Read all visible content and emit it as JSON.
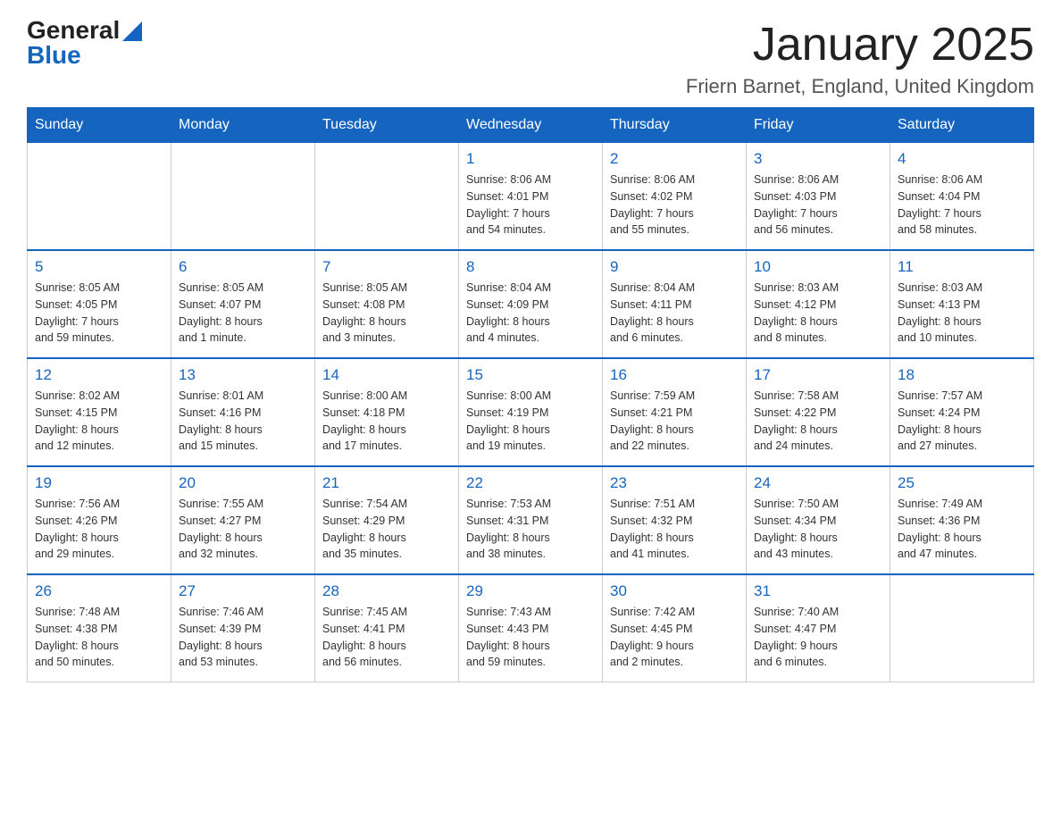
{
  "header": {
    "logo_general": "General",
    "logo_blue": "Blue",
    "title": "January 2025",
    "location": "Friern Barnet, England, United Kingdom"
  },
  "weekdays": [
    "Sunday",
    "Monday",
    "Tuesday",
    "Wednesday",
    "Thursday",
    "Friday",
    "Saturday"
  ],
  "weeks": [
    [
      {
        "day": "",
        "info": ""
      },
      {
        "day": "",
        "info": ""
      },
      {
        "day": "",
        "info": ""
      },
      {
        "day": "1",
        "info": "Sunrise: 8:06 AM\nSunset: 4:01 PM\nDaylight: 7 hours\nand 54 minutes."
      },
      {
        "day": "2",
        "info": "Sunrise: 8:06 AM\nSunset: 4:02 PM\nDaylight: 7 hours\nand 55 minutes."
      },
      {
        "day": "3",
        "info": "Sunrise: 8:06 AM\nSunset: 4:03 PM\nDaylight: 7 hours\nand 56 minutes."
      },
      {
        "day": "4",
        "info": "Sunrise: 8:06 AM\nSunset: 4:04 PM\nDaylight: 7 hours\nand 58 minutes."
      }
    ],
    [
      {
        "day": "5",
        "info": "Sunrise: 8:05 AM\nSunset: 4:05 PM\nDaylight: 7 hours\nand 59 minutes."
      },
      {
        "day": "6",
        "info": "Sunrise: 8:05 AM\nSunset: 4:07 PM\nDaylight: 8 hours\nand 1 minute."
      },
      {
        "day": "7",
        "info": "Sunrise: 8:05 AM\nSunset: 4:08 PM\nDaylight: 8 hours\nand 3 minutes."
      },
      {
        "day": "8",
        "info": "Sunrise: 8:04 AM\nSunset: 4:09 PM\nDaylight: 8 hours\nand 4 minutes."
      },
      {
        "day": "9",
        "info": "Sunrise: 8:04 AM\nSunset: 4:11 PM\nDaylight: 8 hours\nand 6 minutes."
      },
      {
        "day": "10",
        "info": "Sunrise: 8:03 AM\nSunset: 4:12 PM\nDaylight: 8 hours\nand 8 minutes."
      },
      {
        "day": "11",
        "info": "Sunrise: 8:03 AM\nSunset: 4:13 PM\nDaylight: 8 hours\nand 10 minutes."
      }
    ],
    [
      {
        "day": "12",
        "info": "Sunrise: 8:02 AM\nSunset: 4:15 PM\nDaylight: 8 hours\nand 12 minutes."
      },
      {
        "day": "13",
        "info": "Sunrise: 8:01 AM\nSunset: 4:16 PM\nDaylight: 8 hours\nand 15 minutes."
      },
      {
        "day": "14",
        "info": "Sunrise: 8:00 AM\nSunset: 4:18 PM\nDaylight: 8 hours\nand 17 minutes."
      },
      {
        "day": "15",
        "info": "Sunrise: 8:00 AM\nSunset: 4:19 PM\nDaylight: 8 hours\nand 19 minutes."
      },
      {
        "day": "16",
        "info": "Sunrise: 7:59 AM\nSunset: 4:21 PM\nDaylight: 8 hours\nand 22 minutes."
      },
      {
        "day": "17",
        "info": "Sunrise: 7:58 AM\nSunset: 4:22 PM\nDaylight: 8 hours\nand 24 minutes."
      },
      {
        "day": "18",
        "info": "Sunrise: 7:57 AM\nSunset: 4:24 PM\nDaylight: 8 hours\nand 27 minutes."
      }
    ],
    [
      {
        "day": "19",
        "info": "Sunrise: 7:56 AM\nSunset: 4:26 PM\nDaylight: 8 hours\nand 29 minutes."
      },
      {
        "day": "20",
        "info": "Sunrise: 7:55 AM\nSunset: 4:27 PM\nDaylight: 8 hours\nand 32 minutes."
      },
      {
        "day": "21",
        "info": "Sunrise: 7:54 AM\nSunset: 4:29 PM\nDaylight: 8 hours\nand 35 minutes."
      },
      {
        "day": "22",
        "info": "Sunrise: 7:53 AM\nSunset: 4:31 PM\nDaylight: 8 hours\nand 38 minutes."
      },
      {
        "day": "23",
        "info": "Sunrise: 7:51 AM\nSunset: 4:32 PM\nDaylight: 8 hours\nand 41 minutes."
      },
      {
        "day": "24",
        "info": "Sunrise: 7:50 AM\nSunset: 4:34 PM\nDaylight: 8 hours\nand 43 minutes."
      },
      {
        "day": "25",
        "info": "Sunrise: 7:49 AM\nSunset: 4:36 PM\nDaylight: 8 hours\nand 47 minutes."
      }
    ],
    [
      {
        "day": "26",
        "info": "Sunrise: 7:48 AM\nSunset: 4:38 PM\nDaylight: 8 hours\nand 50 minutes."
      },
      {
        "day": "27",
        "info": "Sunrise: 7:46 AM\nSunset: 4:39 PM\nDaylight: 8 hours\nand 53 minutes."
      },
      {
        "day": "28",
        "info": "Sunrise: 7:45 AM\nSunset: 4:41 PM\nDaylight: 8 hours\nand 56 minutes."
      },
      {
        "day": "29",
        "info": "Sunrise: 7:43 AM\nSunset: 4:43 PM\nDaylight: 8 hours\nand 59 minutes."
      },
      {
        "day": "30",
        "info": "Sunrise: 7:42 AM\nSunset: 4:45 PM\nDaylight: 9 hours\nand 2 minutes."
      },
      {
        "day": "31",
        "info": "Sunrise: 7:40 AM\nSunset: 4:47 PM\nDaylight: 9 hours\nand 6 minutes."
      },
      {
        "day": "",
        "info": ""
      }
    ]
  ]
}
